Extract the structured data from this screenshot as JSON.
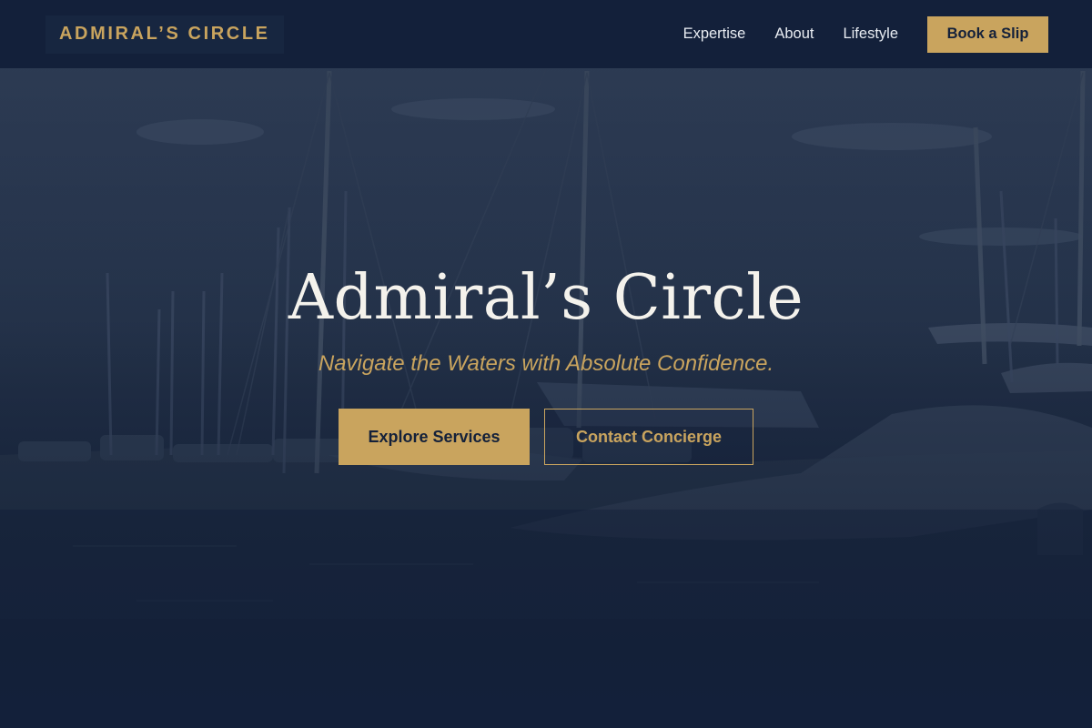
{
  "nav": {
    "brand": "ADMIRAL’S CIRCLE",
    "links": [
      "Expertise",
      "About",
      "Lifestyle"
    ],
    "cta_label": "Book a Slip"
  },
  "hero": {
    "title": "Admiral’s Circle",
    "tagline": "Navigate the Waters with Absolute Confidence.",
    "primary_cta": "Explore Services",
    "secondary_cta": "Contact Concierge"
  },
  "colors": {
    "navy": "#13203a",
    "gold": "#c9a45e",
    "title_text": "#f4f2ec",
    "nav_text": "#e8ecf2"
  }
}
